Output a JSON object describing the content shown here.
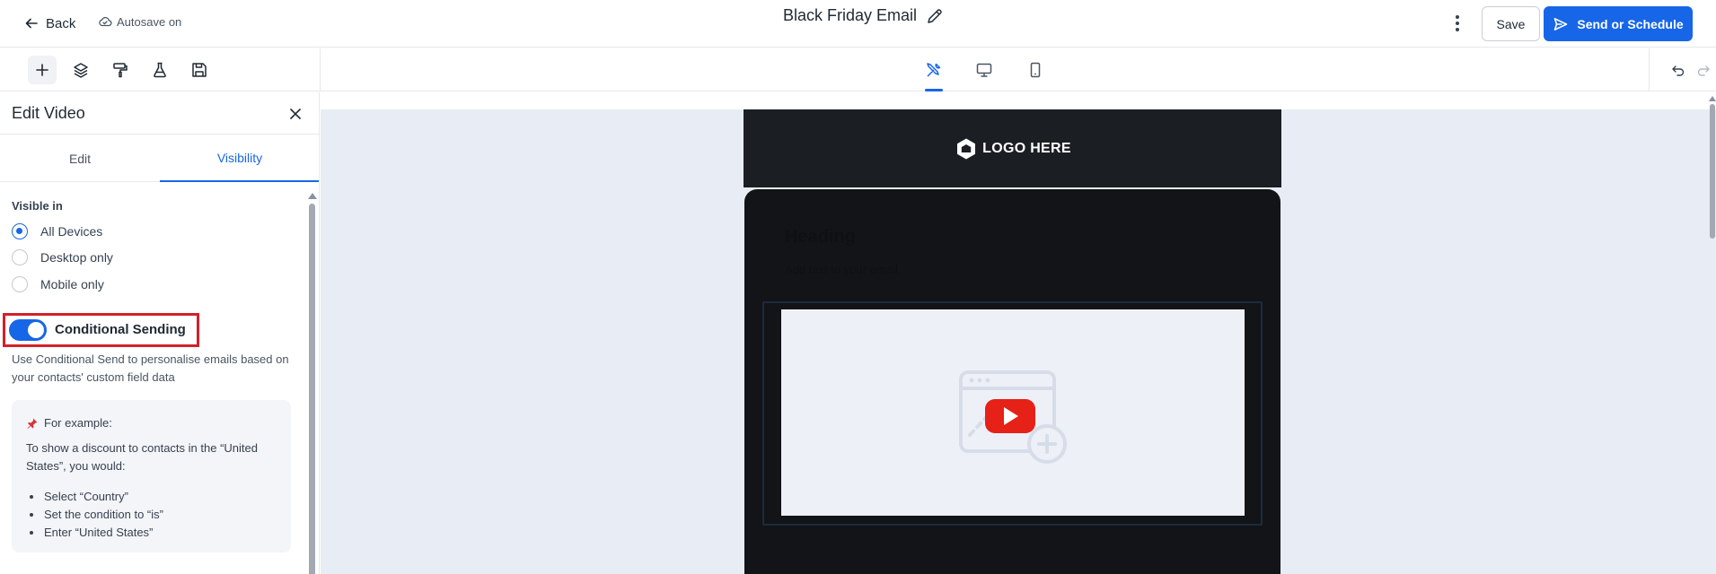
{
  "header": {
    "back_label": "Back",
    "autosave_label": "Autosave on",
    "title": "Black Friday Email",
    "save_label": "Save",
    "send_label": "Send or Schedule"
  },
  "toolbar": {
    "left_tools": [
      "plus-icon",
      "layers-icon",
      "paint-roller-icon",
      "flask-icon",
      "floppy-disk-icon"
    ],
    "view_tools": [
      "tools-icon",
      "desktop-icon",
      "mobile-icon"
    ],
    "history": [
      "undo-icon",
      "redo-icon"
    ]
  },
  "panel": {
    "title": "Edit Video",
    "tabs": [
      {
        "label": "Edit",
        "active": false
      },
      {
        "label": "Visibility",
        "active": true
      }
    ],
    "visible_in_label": "Visible in",
    "options": [
      {
        "label": "All Devices",
        "checked": true
      },
      {
        "label": "Desktop only",
        "checked": false
      },
      {
        "label": "Mobile only",
        "checked": false
      }
    ],
    "conditional": {
      "label": "Conditional Sending",
      "enabled": true,
      "description": "Use Conditional Send to personalise emails based on your contacts' custom field data"
    },
    "example": {
      "heading": "For example:",
      "intro": "To show a discount to contacts in the “United States”, you would:",
      "steps": [
        "Select “Country”",
        "Set the condition to “is”",
        "Enter “United States”"
      ]
    }
  },
  "email": {
    "logo_text": "LOGO HERE",
    "heading": "Heading",
    "body_text": "Add text to your email.",
    "video_placeholder_icon": "youtube-play-icon"
  },
  "colors": {
    "accent": "#1766e8",
    "highlight": "#d3202a",
    "email_dark": "#121417",
    "youtube_red": "#e62117"
  }
}
